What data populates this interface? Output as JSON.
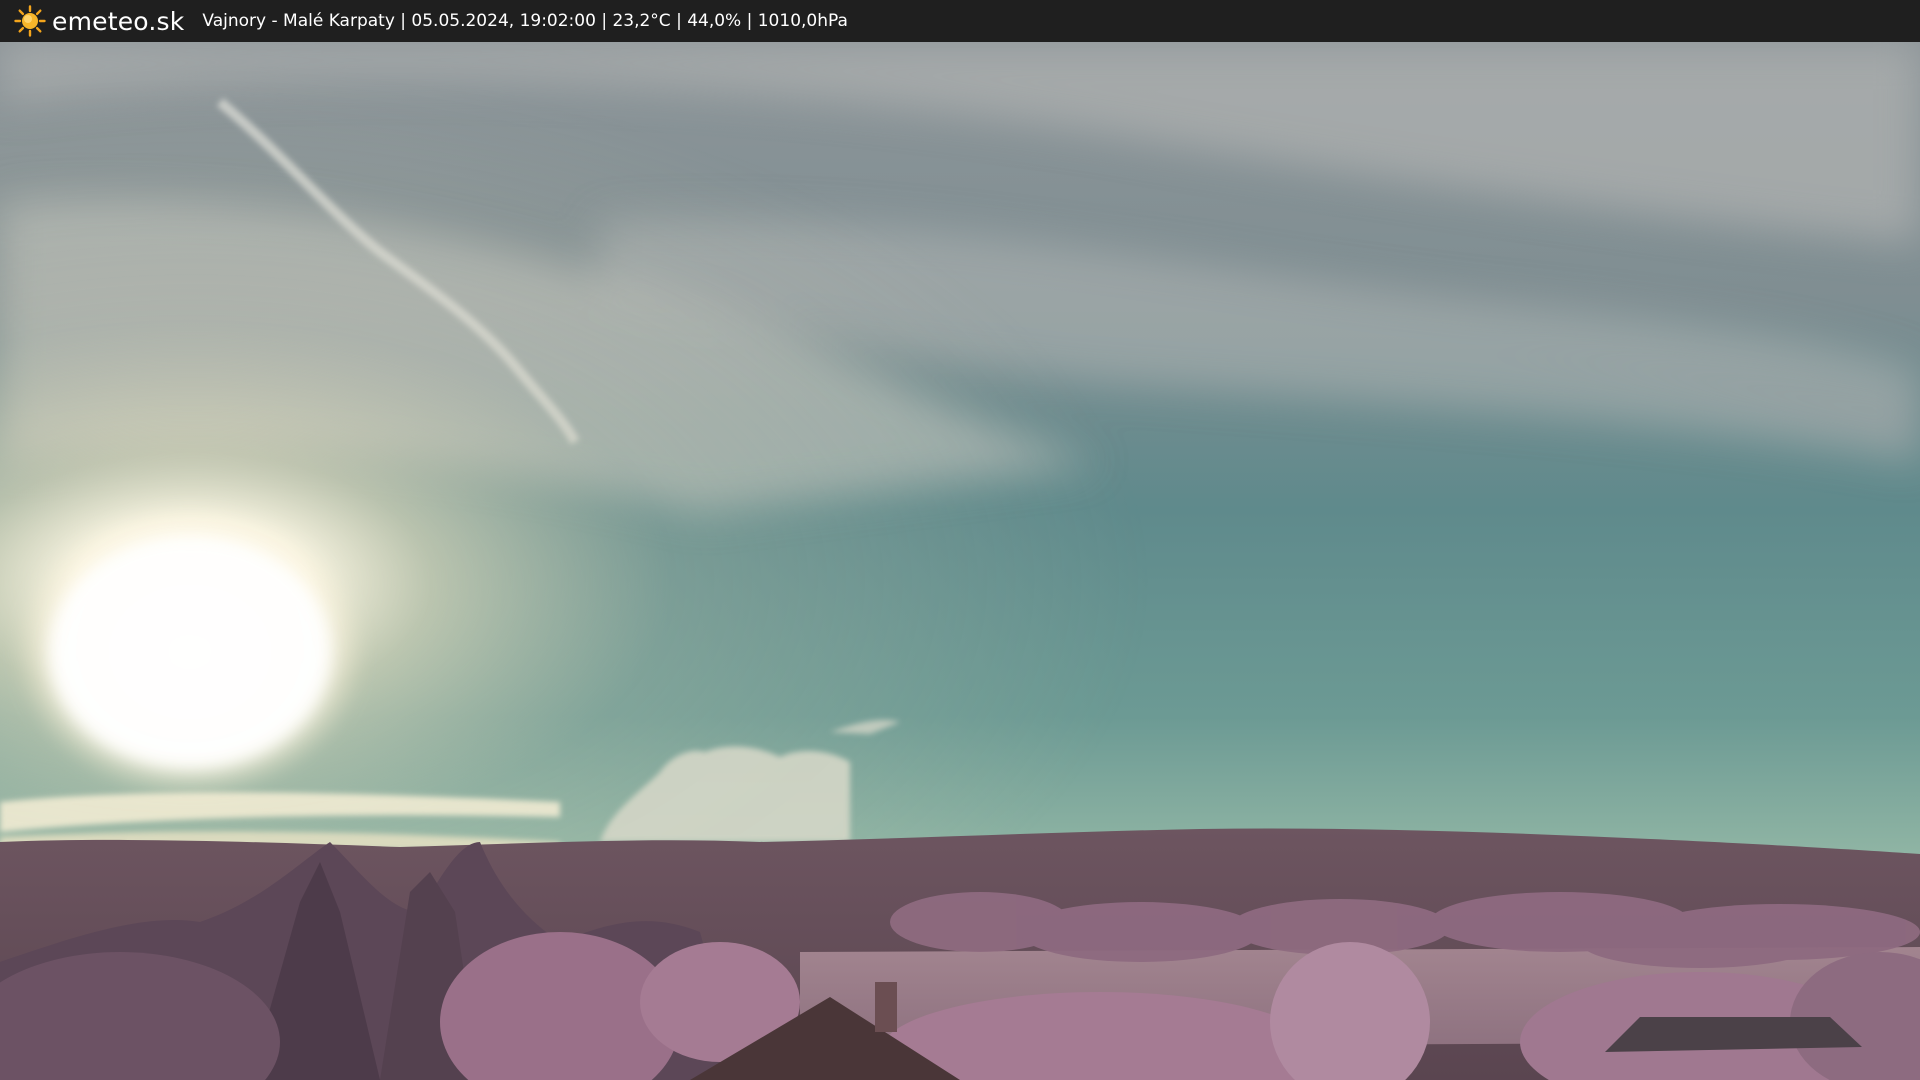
{
  "header": {
    "brand": "emeteo.sk",
    "logo_icon": "sun-icon",
    "caption": "Vajnory - Malé Karpaty | 05.05.2024, 19:02:00 | 23,2°C | 44,0% | 1010,0hPa",
    "background": "#1f1f1f",
    "logo_color": "#f4a51c"
  },
  "scene": {
    "description_icon": "webcam-photo",
    "sky_top": "#8a9498",
    "sky_mid": "#5f8b8c",
    "sky_horizon": "#8fb9a7",
    "sun_color": "#fff8e8",
    "hills_color": "#6a4f5a",
    "foliage_color": "#9a6f86"
  }
}
